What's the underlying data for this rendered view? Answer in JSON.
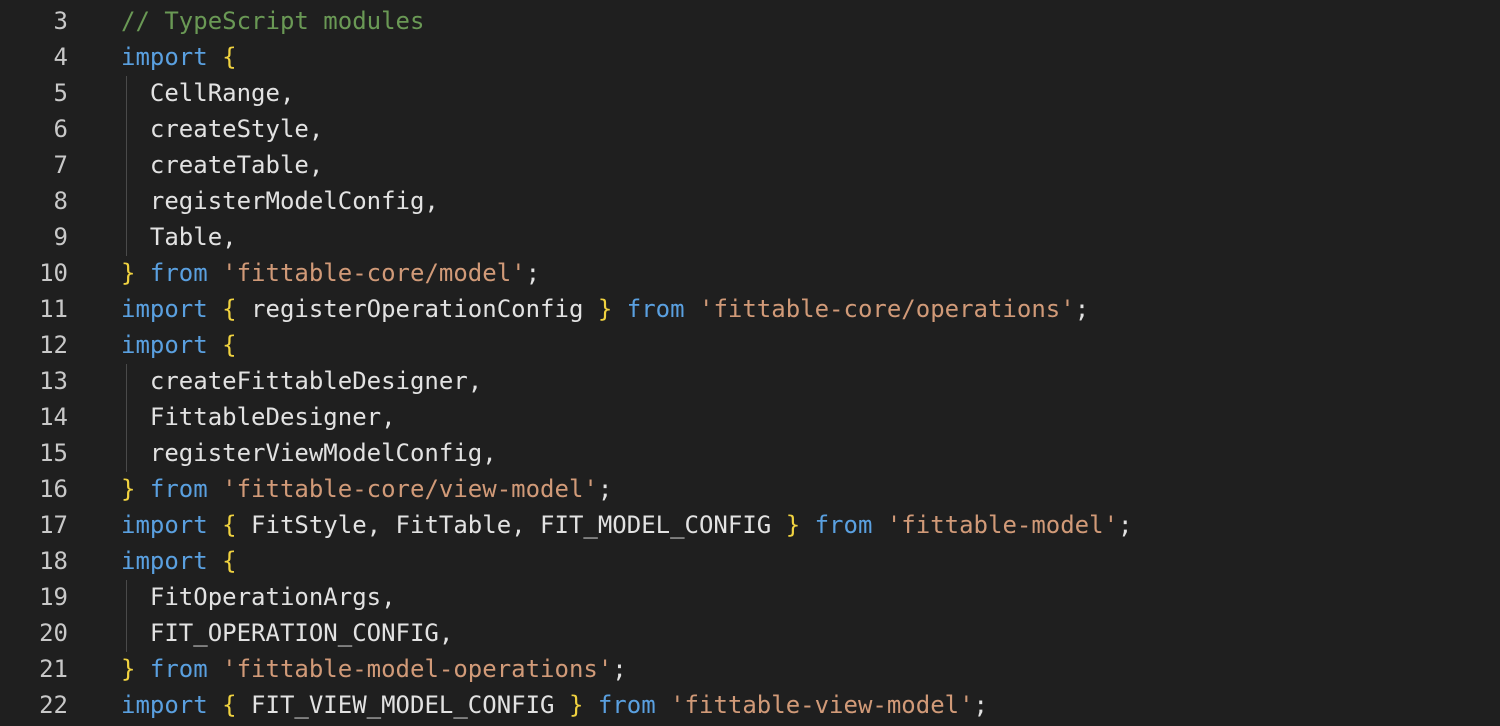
{
  "editor": {
    "colors": {
      "background": "#1f1f1f",
      "line_number": "#c8c8c8",
      "default": "#e2e2e2",
      "keyword": "#5aa0e0",
      "brace": "#f0d240",
      "string": "#d19a78",
      "comment": "#6a9955",
      "indent_guide": "#4a4a4a"
    },
    "lines": [
      {
        "number": "3",
        "tokens": [
          {
            "t": "// TypeScript modules",
            "k": "cm"
          }
        ]
      },
      {
        "number": "4",
        "tokens": [
          {
            "t": "import",
            "k": "kw"
          },
          {
            "t": " ",
            "k": "tok"
          },
          {
            "t": "{",
            "k": "br"
          }
        ]
      },
      {
        "number": "5",
        "tokens": [
          {
            "t": "  CellRange,",
            "k": "tok"
          }
        ]
      },
      {
        "number": "6",
        "tokens": [
          {
            "t": "  createStyle,",
            "k": "tok"
          }
        ]
      },
      {
        "number": "7",
        "tokens": [
          {
            "t": "  createTable,",
            "k": "tok"
          }
        ]
      },
      {
        "number": "8",
        "tokens": [
          {
            "t": "  registerModelConfig,",
            "k": "tok"
          }
        ]
      },
      {
        "number": "9",
        "tokens": [
          {
            "t": "  Table,",
            "k": "tok"
          }
        ]
      },
      {
        "number": "10",
        "tokens": [
          {
            "t": "}",
            "k": "br"
          },
          {
            "t": " ",
            "k": "tok"
          },
          {
            "t": "from",
            "k": "kw"
          },
          {
            "t": " ",
            "k": "tok"
          },
          {
            "t": "'fittable-core/model'",
            "k": "str"
          },
          {
            "t": ";",
            "k": "tok"
          }
        ]
      },
      {
        "number": "11",
        "tokens": [
          {
            "t": "import",
            "k": "kw"
          },
          {
            "t": " ",
            "k": "tok"
          },
          {
            "t": "{",
            "k": "br"
          },
          {
            "t": " registerOperationConfig ",
            "k": "tok"
          },
          {
            "t": "}",
            "k": "br"
          },
          {
            "t": " ",
            "k": "tok"
          },
          {
            "t": "from",
            "k": "kw"
          },
          {
            "t": " ",
            "k": "tok"
          },
          {
            "t": "'fittable-core/operations'",
            "k": "str"
          },
          {
            "t": ";",
            "k": "tok"
          }
        ]
      },
      {
        "number": "12",
        "tokens": [
          {
            "t": "import",
            "k": "kw"
          },
          {
            "t": " ",
            "k": "tok"
          },
          {
            "t": "{",
            "k": "br"
          }
        ]
      },
      {
        "number": "13",
        "tokens": [
          {
            "t": "  createFittableDesigner,",
            "k": "tok"
          }
        ]
      },
      {
        "number": "14",
        "tokens": [
          {
            "t": "  FittableDesigner,",
            "k": "tok"
          }
        ]
      },
      {
        "number": "15",
        "tokens": [
          {
            "t": "  registerViewModelConfig,",
            "k": "tok"
          }
        ]
      },
      {
        "number": "16",
        "tokens": [
          {
            "t": "}",
            "k": "br"
          },
          {
            "t": " ",
            "k": "tok"
          },
          {
            "t": "from",
            "k": "kw"
          },
          {
            "t": " ",
            "k": "tok"
          },
          {
            "t": "'fittable-core/view-model'",
            "k": "str"
          },
          {
            "t": ";",
            "k": "tok"
          }
        ]
      },
      {
        "number": "17",
        "tokens": [
          {
            "t": "import",
            "k": "kw"
          },
          {
            "t": " ",
            "k": "tok"
          },
          {
            "t": "{",
            "k": "br"
          },
          {
            "t": " FitStyle, FitTable, FIT_MODEL_CONFIG ",
            "k": "tok"
          },
          {
            "t": "}",
            "k": "br"
          },
          {
            "t": " ",
            "k": "tok"
          },
          {
            "t": "from",
            "k": "kw"
          },
          {
            "t": " ",
            "k": "tok"
          },
          {
            "t": "'fittable-model'",
            "k": "str"
          },
          {
            "t": ";",
            "k": "tok"
          }
        ]
      },
      {
        "number": "18",
        "tokens": [
          {
            "t": "import",
            "k": "kw"
          },
          {
            "t": " ",
            "k": "tok"
          },
          {
            "t": "{",
            "k": "br"
          }
        ]
      },
      {
        "number": "19",
        "tokens": [
          {
            "t": "  FitOperationArgs,",
            "k": "tok"
          }
        ]
      },
      {
        "number": "20",
        "tokens": [
          {
            "t": "  FIT_OPERATION_CONFIG,",
            "k": "tok"
          }
        ]
      },
      {
        "number": "21",
        "tokens": [
          {
            "t": "}",
            "k": "br"
          },
          {
            "t": " ",
            "k": "tok"
          },
          {
            "t": "from",
            "k": "kw"
          },
          {
            "t": " ",
            "k": "tok"
          },
          {
            "t": "'fittable-model-operations'",
            "k": "str"
          },
          {
            "t": ";",
            "k": "tok"
          }
        ]
      },
      {
        "number": "22",
        "tokens": [
          {
            "t": "import",
            "k": "kw"
          },
          {
            "t": " ",
            "k": "tok"
          },
          {
            "t": "{",
            "k": "br"
          },
          {
            "t": " FIT_VIEW_MODEL_CONFIG ",
            "k": "tok"
          },
          {
            "t": "}",
            "k": "br"
          },
          {
            "t": " ",
            "k": "tok"
          },
          {
            "t": "from",
            "k": "kw"
          },
          {
            "t": " ",
            "k": "tok"
          },
          {
            "t": "'fittable-view-model'",
            "k": "str"
          },
          {
            "t": ";",
            "k": "tok"
          }
        ]
      }
    ]
  }
}
